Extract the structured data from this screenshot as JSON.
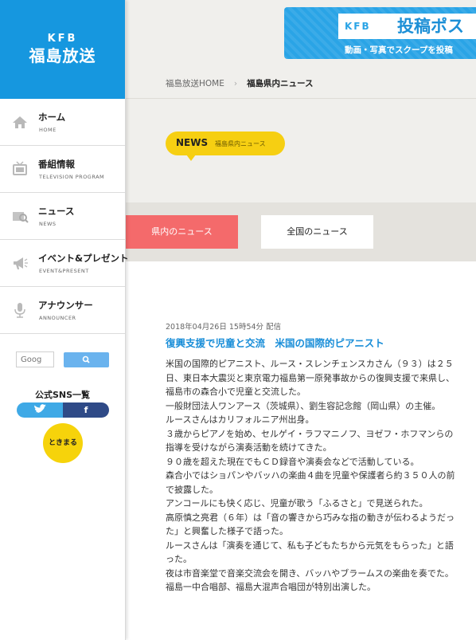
{
  "brand": {
    "logo_top": "KFB",
    "logo_name": "福島放送"
  },
  "nav": [
    {
      "jp": "ホーム",
      "en": "HOME",
      "icon": "home-icon"
    },
    {
      "jp": "番組情報",
      "en": "TELEVISION PROGRAM",
      "icon": "tv-icon"
    },
    {
      "jp": "ニュース",
      "en": "NEWS",
      "icon": "news-icon"
    },
    {
      "jp": "イベント&プレゼント",
      "en": "EVENT&PRESENT",
      "icon": "megaphone-icon"
    },
    {
      "jp": "アナウンサー",
      "en": "ANNOUNCER",
      "icon": "microphone-icon"
    }
  ],
  "search": {
    "placeholder": "Goog"
  },
  "sns": {
    "title": "公式SNS一覧",
    "facebook": "f",
    "tokimeru": "ときまる"
  },
  "banner": {
    "kfb": "KFB",
    "title": "投稿ポス",
    "subtitle": "動画・写真でスクープを投稿"
  },
  "breadcrumb": {
    "home": "福島放送HOME",
    "sep": "›",
    "current": "福島県内ニュース"
  },
  "section_badge": {
    "en": "NEWS",
    "jp": "福島県内ニュース"
  },
  "tabs": [
    {
      "label": "県内のニュース",
      "active": true
    },
    {
      "label": "全国のニュース",
      "active": false
    }
  ],
  "article": {
    "meta": "2018年04月26日 15時54分 配信",
    "title": "復興支援で児童と交流　米国の国際的ピアニスト",
    "paragraphs": [
      "米国の国際的ピアニスト、ルース・スレンチェンスカさん（９３）は２５日、東日本大震災と東京電力福島第一原発事故からの復興支援で来県し、福島市の森合小で児童と交流した。",
      "一般財団法人ワンアース（茨城県）、劉生容記念館（岡山県）の主催。",
      "ルースさんはカリフォルニア州出身。",
      "３歳からピアノを始め、セルゲイ・ラフマニノフ、ヨゼフ・ホフマンらの指導を受けながら演奏活動を続けてきた。",
      "９０歳を超えた現在でもＣＤ録音や演奏会などで活動している。",
      "森合小ではショパンやバッハの楽曲４曲を児童や保護者ら約３５０人の前で披露した。",
      "アンコールにも快く応じ、児童が歌う「ふるさと」で見送られた。",
      "高原慎之亮君（６年）は「音の響きから巧みな指の動きが伝わるようだった」と興奮した様子で語った。",
      "ルースさんは「演奏を通じて、私も子どもたちから元気をもらった」と語った。",
      "夜は市音楽堂で音楽交流会を開き、バッハやブラームスの楽曲を奏でた。",
      "福島一中合唱部、福島大混声合唱団が特別出演した。"
    ]
  },
  "colors": {
    "brand_blue": "#1697df",
    "tab_active": "#f46a6b",
    "badge_yellow": "#f6cf12",
    "title_blue": "#1a8ed8"
  }
}
